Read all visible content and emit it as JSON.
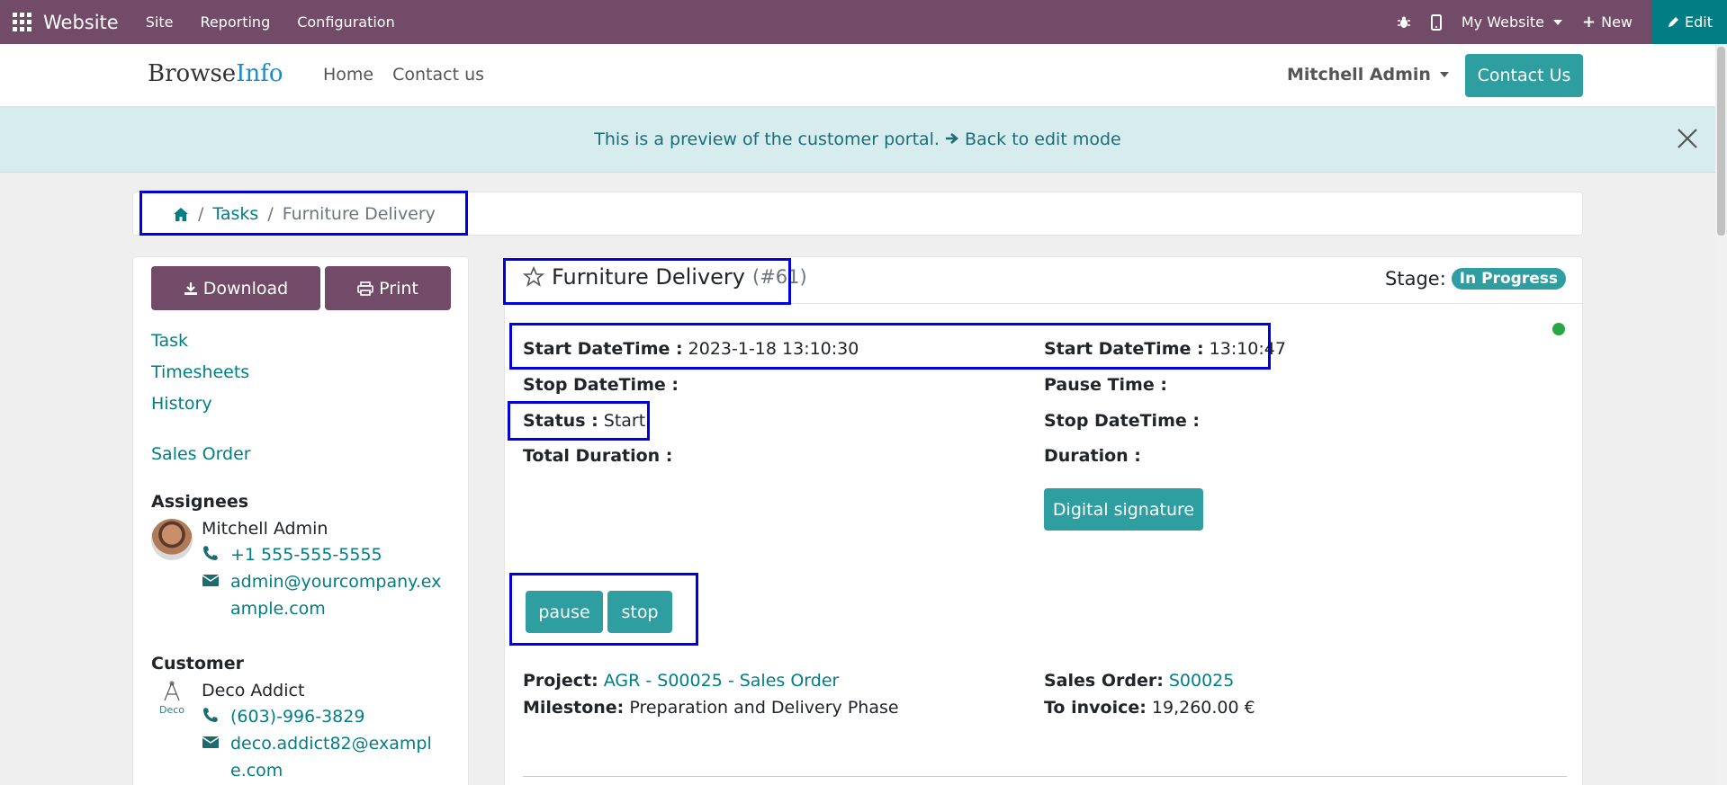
{
  "topbar": {
    "brand": "Website",
    "menu": [
      "Site",
      "Reporting",
      "Configuration"
    ],
    "website_select": "My Website",
    "new_label": "New",
    "edit_label": "Edit"
  },
  "header": {
    "logo_part1": "Browse",
    "logo_part2": "Info",
    "nav": [
      "Home",
      "Contact us"
    ],
    "user": "Mitchell Admin",
    "contact_button": "Contact Us"
  },
  "banner": {
    "text": "This is a preview of the customer portal.",
    "link": "Back to edit mode"
  },
  "breadcrumb": {
    "tasks": "Tasks",
    "current": "Furniture Delivery"
  },
  "sidebar": {
    "download": "Download",
    "print": "Print",
    "links": [
      "Task",
      "Timesheets",
      "History"
    ],
    "sales_order": "Sales Order",
    "assignees_heading": "Assignees",
    "assignee": {
      "name": "Mitchell Admin",
      "phone": "+1 555-555-5555",
      "email": "admin@yourcompany.example.com"
    },
    "customer_heading": "Customer",
    "customer": {
      "name": "Deco Addict",
      "logo_text": "Deco",
      "phone": "(603)-996-3829",
      "email": "deco.addict82@example.com"
    }
  },
  "task": {
    "title": "Furniture Delivery",
    "number": "(#61)",
    "stage_label": "Stage:",
    "stage": "In Progress",
    "status_dot_color": "#28a745",
    "fields": {
      "start_datetime_label": "Start DateTime :",
      "start_datetime_value": "2023-1-18 13:10:30",
      "start_datetime2_label": "Start DateTime :",
      "start_datetime2_value": "13:10:47",
      "stop_datetime_label": "Stop DateTime :",
      "pause_time_label": "Pause Time :",
      "status_label": "Status :",
      "status_value": "Start",
      "stop_datetime2_label": "Stop DateTime :",
      "total_duration_label": "Total Duration :",
      "duration_label": "Duration :"
    },
    "digital_signature": "Digital signature",
    "pause": "pause",
    "stop": "stop",
    "project_label": "Project:",
    "project_value": "AGR - S00025 - Sales Order",
    "milestone_label": "Milestone:",
    "milestone_value": "Preparation and Delivery Phase",
    "sales_order_label": "Sales Order:",
    "sales_order_value": "S00025",
    "to_invoice_label": "To invoice:",
    "to_invoice_value": "19,260.00 €"
  },
  "colors": {
    "topbar": "#714b67",
    "accent": "#2e9ea1",
    "link": "#017e84",
    "highlight": "#0000e0"
  }
}
